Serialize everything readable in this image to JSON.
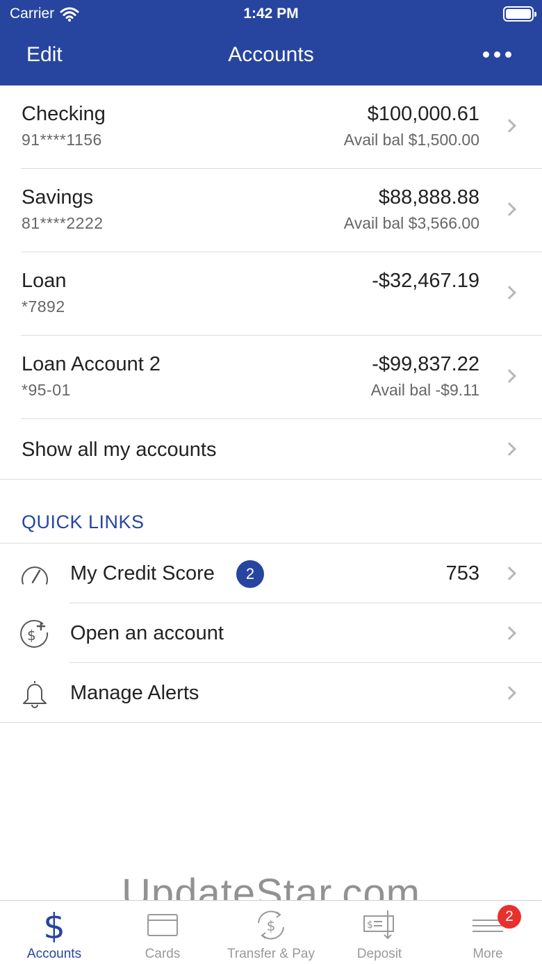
{
  "status_bar": {
    "carrier": "Carrier",
    "time": "1:42 PM"
  },
  "nav": {
    "edit_label": "Edit",
    "title": "Accounts",
    "more_icon": "ellipsis-icon"
  },
  "accounts": [
    {
      "name": "Checking",
      "number": "91****1156",
      "balance": "$100,000.61",
      "avail": "Avail bal $1,500.00"
    },
    {
      "name": "Savings",
      "number": "81****2222",
      "balance": "$88,888.88",
      "avail": "Avail bal $3,566.00"
    },
    {
      "name": "Loan",
      "number": "*7892",
      "balance": "-$32,467.19",
      "avail": ""
    },
    {
      "name": "Loan Account 2",
      "number": "*95-01",
      "balance": "-$99,837.22",
      "avail": "Avail bal -$9.11"
    }
  ],
  "show_all_label": "Show all my accounts",
  "quick_links": {
    "header": "QUICK LINKS",
    "items": [
      {
        "label": "My Credit Score",
        "badge": "2",
        "value": "753",
        "icon": "gauge-icon"
      },
      {
        "label": "Open an account",
        "icon": "dollar-plus-icon"
      },
      {
        "label": "Manage Alerts",
        "icon": "bell-icon"
      }
    ]
  },
  "watermark": "UpdateStar.com",
  "tabs": [
    {
      "label": "Accounts",
      "icon": "dollar-icon",
      "active": true
    },
    {
      "label": "Cards",
      "icon": "card-icon"
    },
    {
      "label": "Transfer & Pay",
      "icon": "transfer-icon"
    },
    {
      "label": "Deposit",
      "icon": "check-deposit-icon"
    },
    {
      "label": "More",
      "icon": "menu-icon",
      "badge": "2"
    }
  ],
  "colors": {
    "brand": "#27459f",
    "badge_red": "#e8302e",
    "muted": "#999999"
  }
}
